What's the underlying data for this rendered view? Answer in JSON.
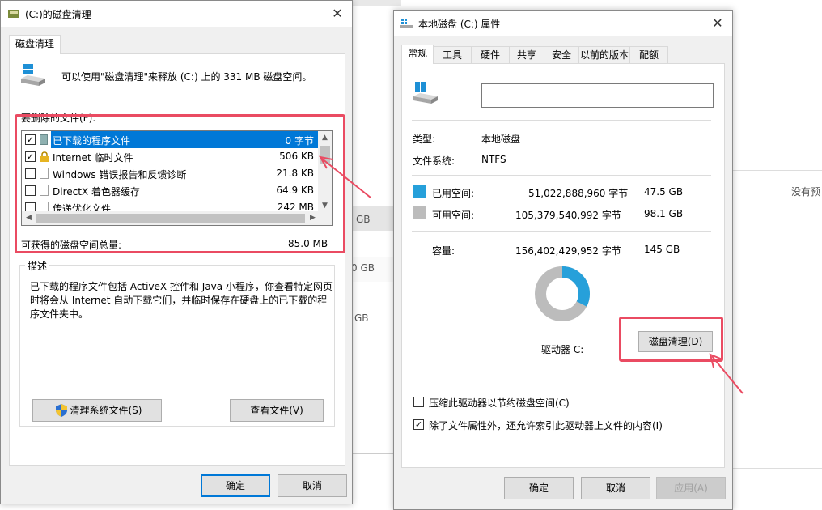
{
  "background": {
    "hint_right": "没有预",
    "gb_1": "GB",
    "gb_2": "0 GB",
    "gb_3": "GB"
  },
  "cleanup": {
    "title": "(C:)的磁盘清理",
    "tab": "磁盘清理",
    "intro": "可以使用\"磁盘清理\"来释放 (C:) 上的 331 MB 磁盘空间。",
    "files_label": "要删除的文件(F):",
    "files": [
      {
        "name": "已下载的程序文件",
        "size": "0 字节",
        "checked": true,
        "selected": true
      },
      {
        "name": "Internet 临时文件",
        "size": "506 KB",
        "checked": true,
        "selected": false
      },
      {
        "name": "Windows 错误报告和反馈诊断",
        "size": "21.8 KB",
        "checked": false,
        "selected": false
      },
      {
        "name": "DirectX 着色器缓存",
        "size": "64.9 KB",
        "checked": false,
        "selected": false
      },
      {
        "name": "传递优化文件",
        "size": "242 MB",
        "checked": false,
        "selected": false
      }
    ],
    "total_label": "可获得的磁盘空间总量:",
    "total_value": "85.0 MB",
    "desc_title": "描述",
    "desc_text": "已下载的程序文件包括 ActiveX 控件和 Java 小程序，你查看特定网页时将会从 Internet 自动下载它们，并临时保存在硬盘上的已下载的程序文件夹中。",
    "clean_system_btn": "清理系统文件(S)",
    "view_files_btn": "查看文件(V)",
    "ok_btn": "确定",
    "cancel_btn": "取消"
  },
  "props": {
    "title": "本地磁盘 (C:) 属性",
    "tabs": [
      "常规",
      "工具",
      "硬件",
      "共享",
      "安全",
      "以前的版本",
      "配额"
    ],
    "name_value": "",
    "type_label": "类型:",
    "type_value": "本地磁盘",
    "fs_label": "文件系统:",
    "fs_value": "NTFS",
    "used_label": "已用空间:",
    "used_bytes": "51,022,888,960 字节",
    "used_gb": "47.5 GB",
    "free_label": "可用空间:",
    "free_bytes": "105,379,540,992 字节",
    "free_gb": "98.1 GB",
    "cap_label": "容量:",
    "cap_bytes": "156,402,429,952 字节",
    "cap_gb": "145 GB",
    "drive_label": "驱动器 C:",
    "cleanup_btn": "磁盘清理(D)",
    "compress_label": "压缩此驱动器以节约磁盘空间(C)",
    "compress_checked": false,
    "index_label": "除了文件属性外，还允许索引此驱动器上文件的内容(I)",
    "index_checked": true,
    "ok_btn": "确定",
    "cancel_btn": "取消",
    "apply_btn": "应用(A)",
    "used_fraction": 0.326,
    "colors": {
      "used": "#26a0da",
      "free": "#bcbcbc"
    }
  }
}
